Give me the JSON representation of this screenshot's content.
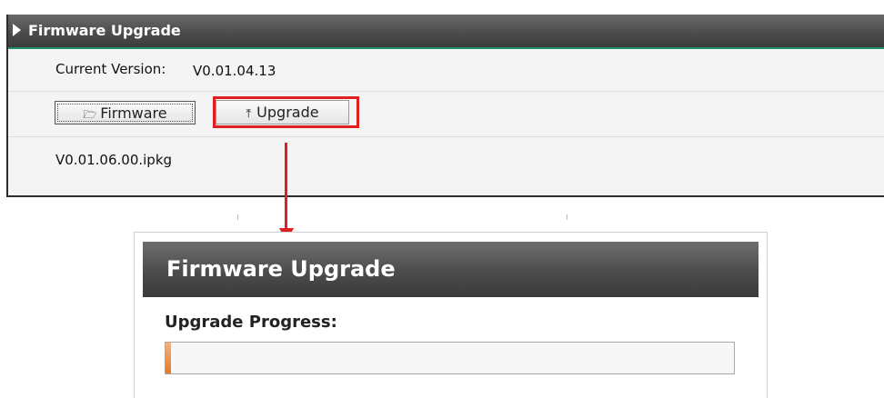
{
  "top_panel": {
    "title": "Firmware Upgrade",
    "current_version_label": "Current Version:",
    "current_version_value": "V0.01.04.13",
    "firmware_button_label": "Firmware",
    "upgrade_button_label": "Upgrade",
    "selected_file": "V0.01.06.00.ipkg"
  },
  "dialog": {
    "title": "Firmware Upgrade",
    "progress_label": "Upgrade Progress:",
    "progress_percent": 1
  },
  "icons": {
    "firmware_icon": "folder-open-icon",
    "upgrade_icon": "upload-icon"
  },
  "colors": {
    "highlight": "#e02020",
    "progress_fill": "#e07a2e",
    "header_accent": "#1f8f6a"
  }
}
